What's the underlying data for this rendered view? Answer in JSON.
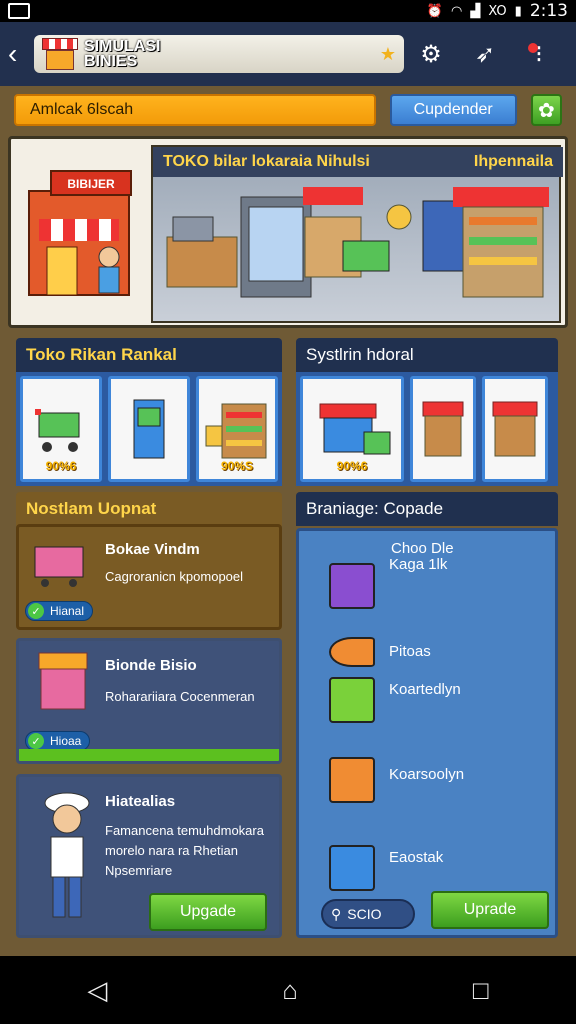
{
  "status": {
    "time": "2:13",
    "net": "XO"
  },
  "topbar": {
    "title_line1": "SIMULASI",
    "title_line2": "BINIES"
  },
  "row1": {
    "input_value": "Amlcak 6lscah",
    "button": "Cupdender"
  },
  "hero": {
    "title_left": "TOKO bilar lokaraia Nihulsi",
    "title_right": "Ihpennaila",
    "store_sign": "BIBIJER"
  },
  "sections": {
    "left_tiles_title": "Toko Rikan Rankal",
    "right_tiles_title": "Systlrin hdoral",
    "left_tiles": [
      {
        "price": "90%6"
      },
      {
        "price": ""
      },
      {
        "price": "90%S"
      }
    ],
    "right_tiles": [
      {
        "price": "90%6"
      },
      {
        "price": ""
      },
      {
        "price": ""
      }
    ]
  },
  "cards": [
    {
      "header": "Nostlam Uopnat",
      "title": "Bokae Vindm",
      "desc": "Cagroranicn kpomopoel",
      "pill": "Hianal"
    },
    {
      "title": "Bionde Bisio",
      "desc": "Roharariiara Cocenmeran",
      "pill": "Hioaa"
    },
    {
      "title": "Hiatealias",
      "desc_line1": "Famancena temuhdmokara",
      "desc_line2": "morelo nara ra Rhetian",
      "desc_line3": "Npsemriare",
      "button": "Upgade"
    }
  ],
  "right_panel": {
    "header": "Braniage: Copade",
    "items": [
      "Choo Dle",
      "Kaga 1lk",
      "Pitoas",
      "Koartedlyn",
      "Koarsoolyn",
      "Eaostak"
    ],
    "search": "SCIO",
    "button": "Uprade"
  }
}
